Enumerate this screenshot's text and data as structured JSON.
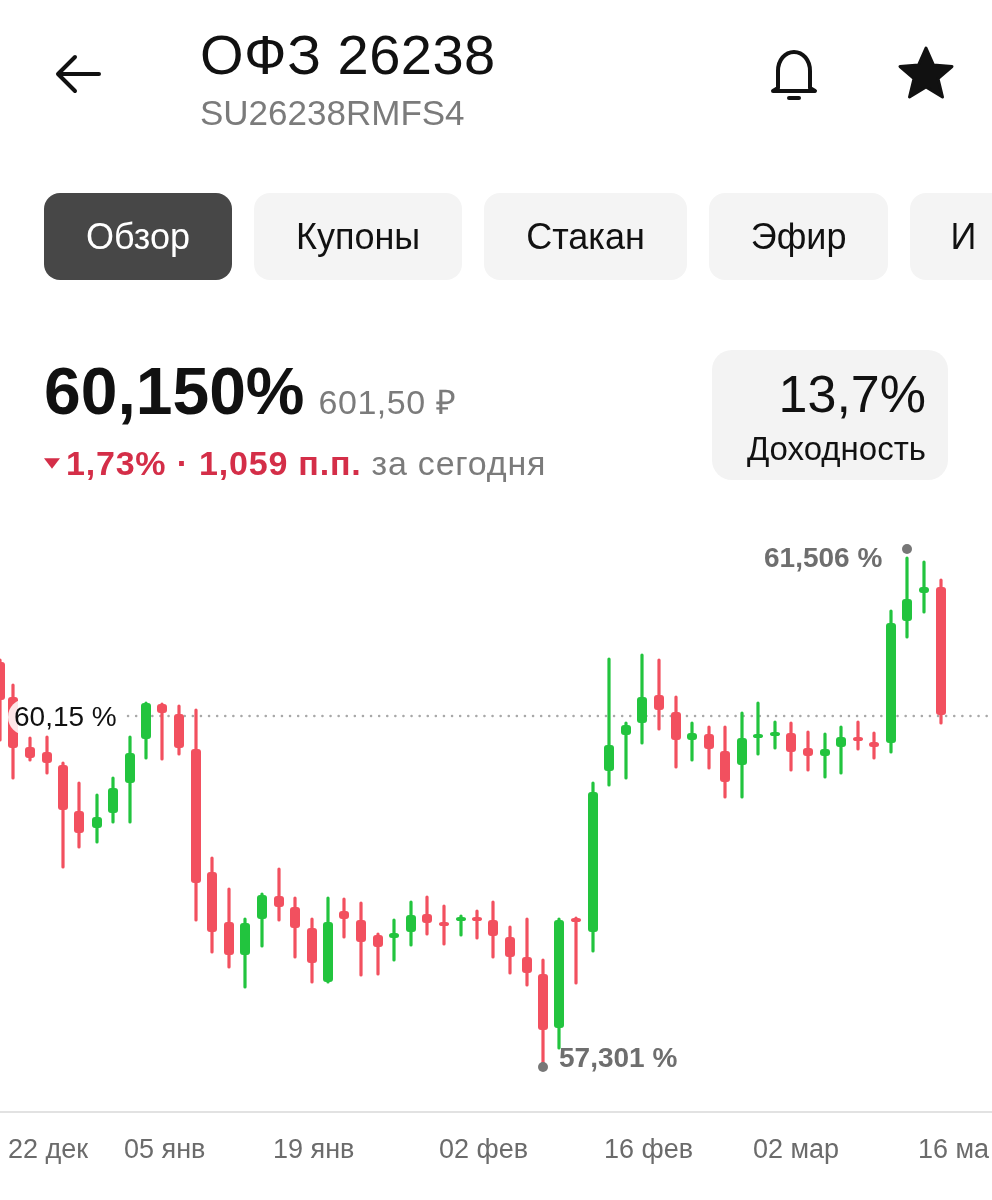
{
  "header": {
    "title": "ОФЗ 26238",
    "isin": "SU26238RMFS4"
  },
  "tabs": [
    {
      "label": "Обзор",
      "selected": true
    },
    {
      "label": "Купоны",
      "selected": false
    },
    {
      "label": "Стакан",
      "selected": false
    },
    {
      "label": "Эфир",
      "selected": false
    },
    {
      "label": "И",
      "selected": false
    }
  ],
  "quote": {
    "price_percent": "60,150%",
    "price_rub": "601,50 ₽",
    "down": true,
    "change": "1,73% · 1,059 п.п.",
    "period": "за сегодня"
  },
  "yield_card": {
    "value": "13,7%",
    "label": "Доходность"
  },
  "chart": {
    "current_label": "60,15 %",
    "max_label": "61,506 %",
    "min_label": "57,301 %",
    "x_axis_labels": [
      "22 дек",
      "05 янв",
      "19 янв",
      "02 фев",
      "16 фев",
      "02 мар",
      "16 ма"
    ]
  }
}
